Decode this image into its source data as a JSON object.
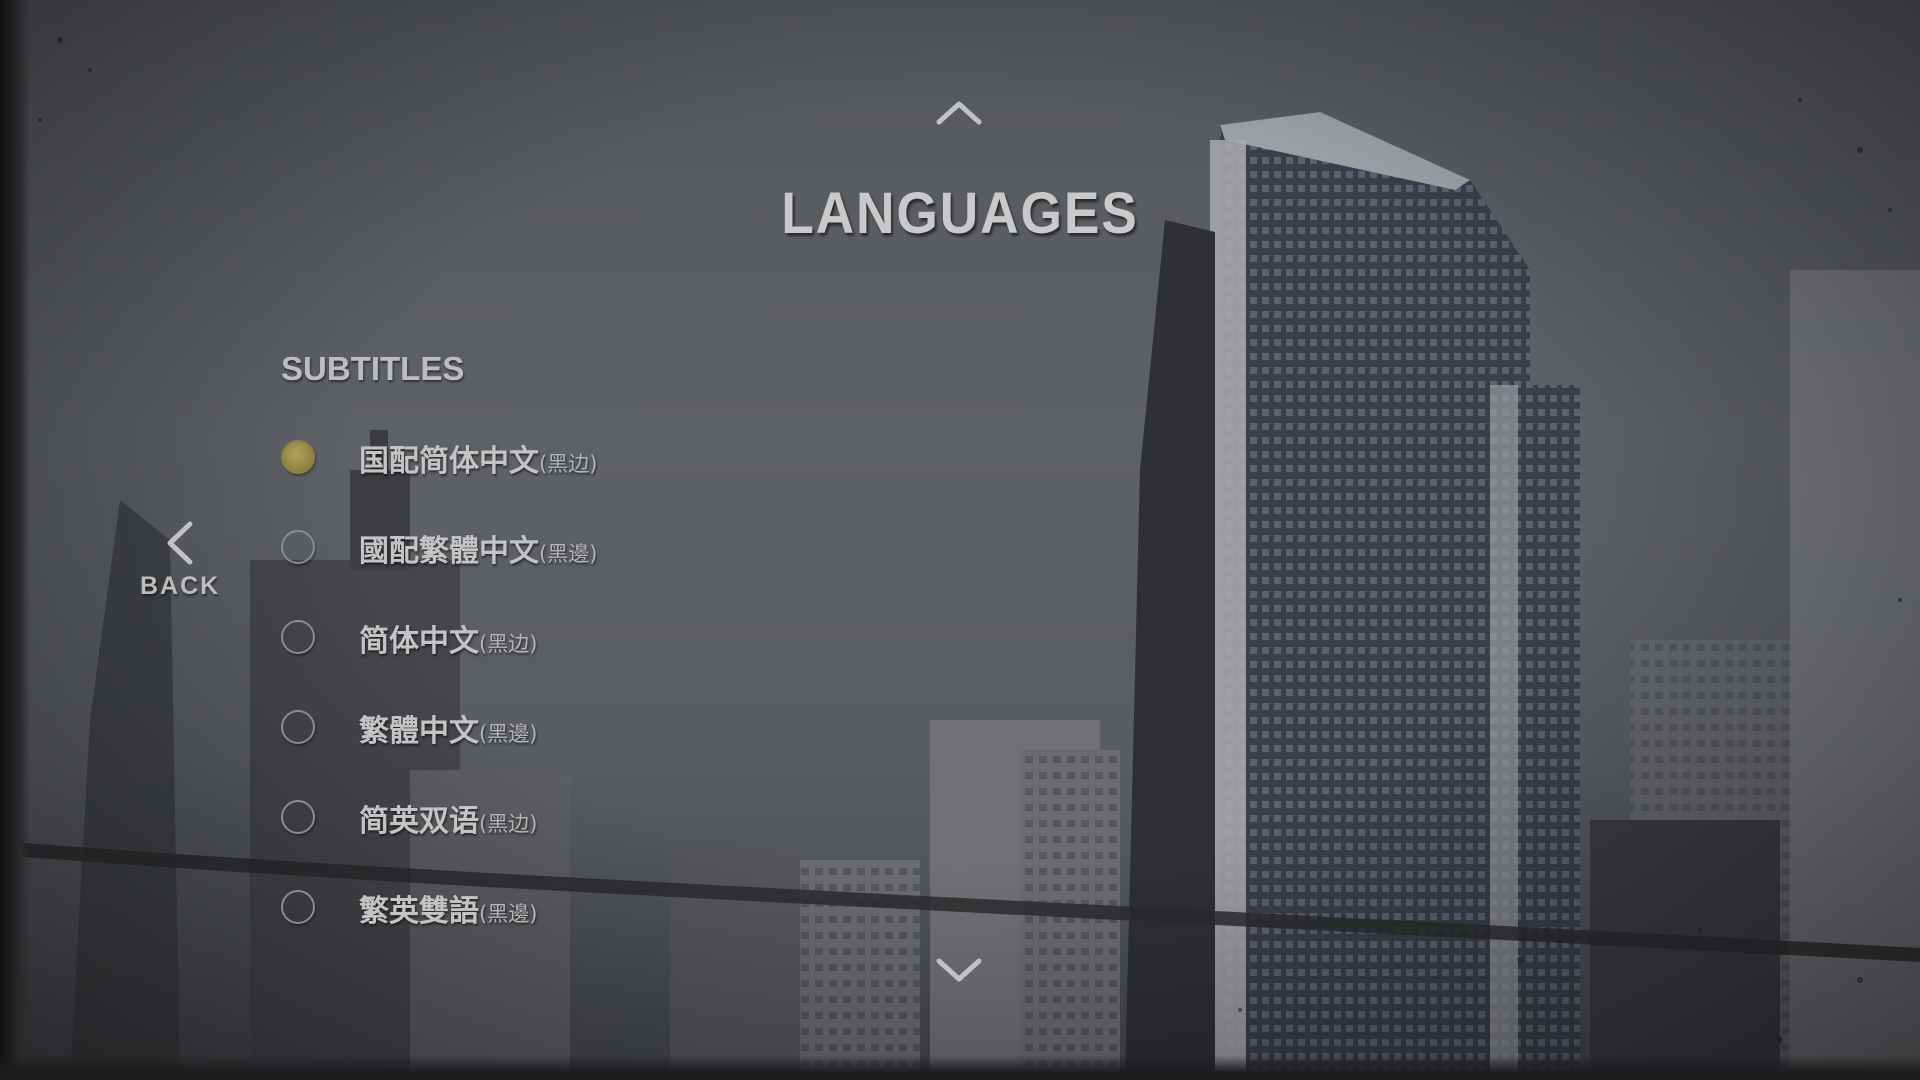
{
  "screen": {
    "title": "LANGUAGES",
    "back_label": "BACK",
    "section_title": "SUBTITLES",
    "icons": {
      "up": "chevron-up-icon",
      "down": "chevron-down-icon",
      "back": "chevron-left-icon"
    },
    "colors": {
      "text": "#c4c4c4",
      "selected_radio": "#9c8f4a"
    }
  },
  "subtitles": [
    {
      "label": "国配简体中文",
      "suffix": "(黑边)",
      "selected": true
    },
    {
      "label": "國配繁體中文",
      "suffix": "(黑邊)",
      "selected": false
    },
    {
      "label": "简体中文",
      "suffix": "(黑边)",
      "selected": false
    },
    {
      "label": "繁體中文",
      "suffix": "(黑邊)",
      "selected": false
    },
    {
      "label": "简英双语",
      "suffix": "(黑边)",
      "selected": false
    },
    {
      "label": "繁英雙語",
      "suffix": "(黑邊)",
      "selected": false
    }
  ]
}
